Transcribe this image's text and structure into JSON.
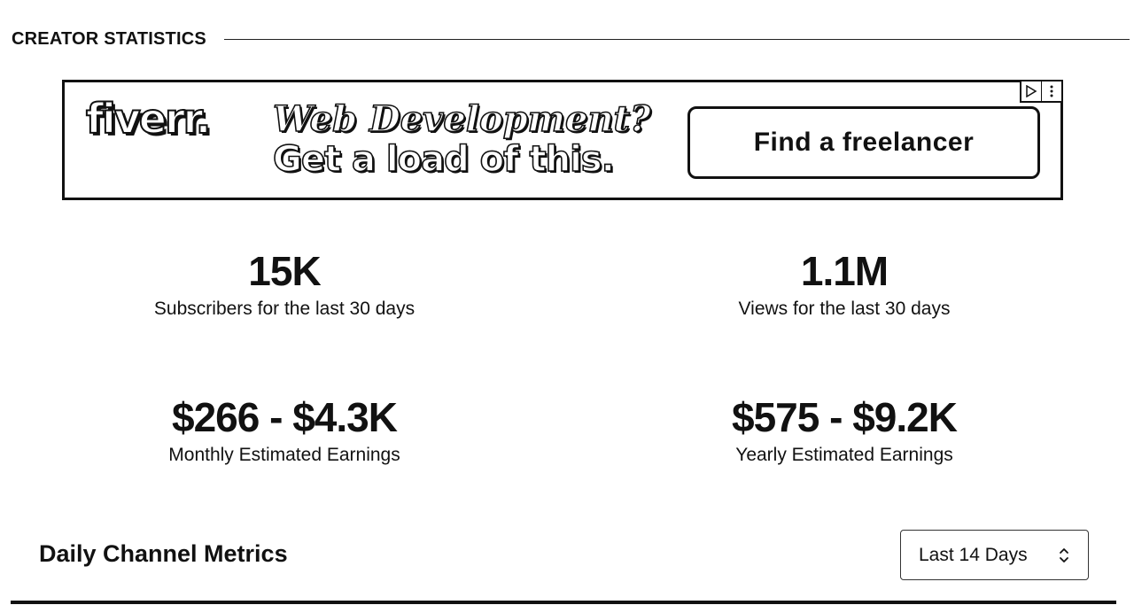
{
  "section": {
    "title": "CREATOR STATISTICS"
  },
  "ad": {
    "brand": "fiverr.",
    "headline_line1": "Web Development?",
    "headline_line2": "Get a load of this.",
    "cta_label": "Find a freelancer",
    "adchoices_icon": "play-triangle-icon",
    "menu_icon": "vertical-dots-icon"
  },
  "stats": {
    "subscribers": {
      "value": "15K",
      "label": "Subscribers for the last 30 days"
    },
    "views": {
      "value": "1.1M",
      "label": "Views for the last 30 days"
    },
    "monthly": {
      "value": "$266 - $4.3K",
      "label": "Monthly Estimated Earnings"
    },
    "yearly": {
      "value": "$575 - $9.2K",
      "label": "Yearly Estimated Earnings"
    }
  },
  "daily": {
    "title": "Daily Channel Metrics",
    "range_selected": "Last 14 Days"
  }
}
